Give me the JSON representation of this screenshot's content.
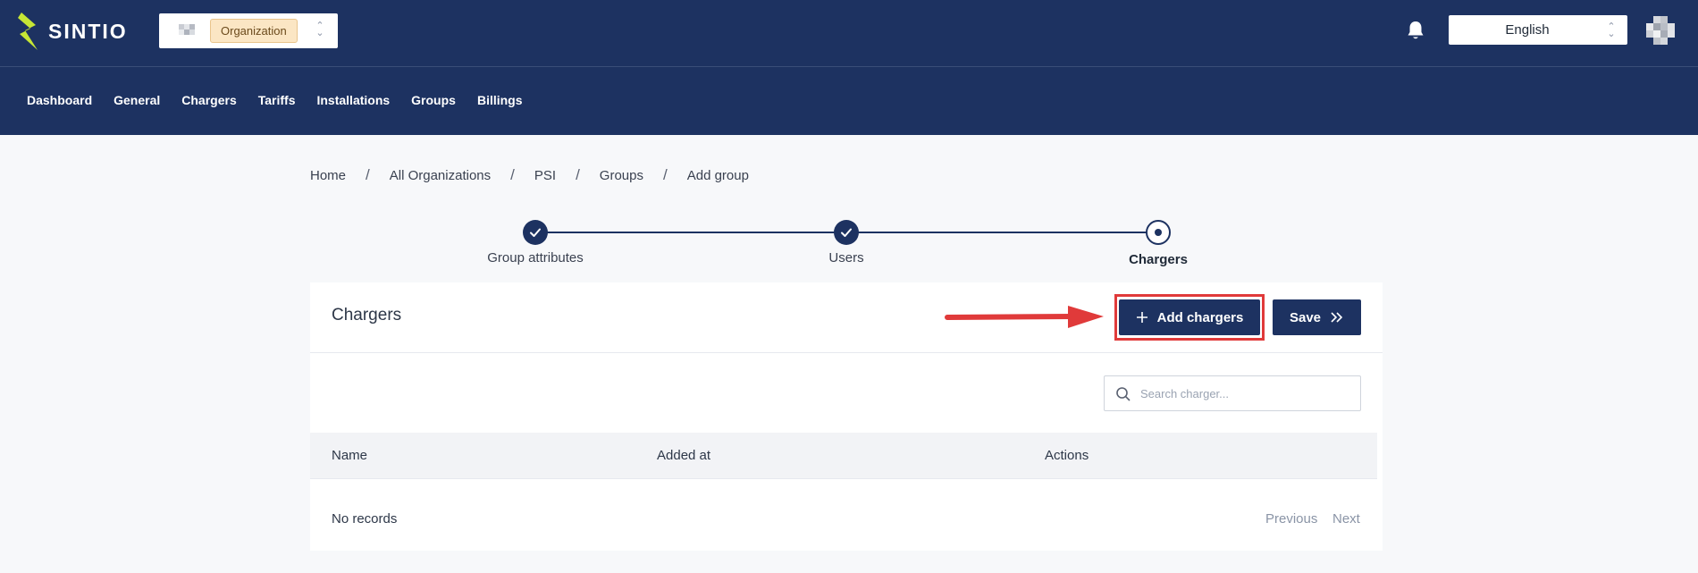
{
  "app": {
    "brand": "SINTIO",
    "colors": {
      "primary": "#1d3261",
      "accent": "#c6e635",
      "annotation": "#e03a3a"
    }
  },
  "header": {
    "org_selector": {
      "badge": "Organization"
    },
    "notifications_icon": "bell-icon",
    "language_selector": {
      "value": "English"
    }
  },
  "nav": {
    "items": [
      {
        "label": "Dashboard"
      },
      {
        "label": "General"
      },
      {
        "label": "Chargers"
      },
      {
        "label": "Tariffs"
      },
      {
        "label": "Installations"
      },
      {
        "label": "Groups"
      },
      {
        "label": "Billings"
      }
    ]
  },
  "breadcrumb": {
    "items": [
      "Home",
      "All Organizations",
      "PSI",
      "Groups",
      "Add group"
    ],
    "separator": "/"
  },
  "stepper": {
    "steps": [
      {
        "label": "Group attributes",
        "state": "done"
      },
      {
        "label": "Users",
        "state": "done"
      },
      {
        "label": "Chargers",
        "state": "current"
      }
    ]
  },
  "card": {
    "title": "Chargers",
    "add_button": "Add chargers",
    "save_button": "Save",
    "search": {
      "placeholder": "Search charger...",
      "value": ""
    },
    "table": {
      "columns": [
        "Name",
        "Added at",
        "Actions"
      ],
      "empty_text": "No records"
    },
    "pagination": {
      "previous": "Previous",
      "next": "Next"
    }
  }
}
